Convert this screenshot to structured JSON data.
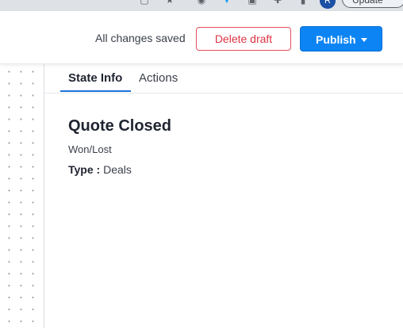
{
  "browser": {
    "update_label": "Update",
    "profile_initial": "R"
  },
  "header": {
    "save_status": "All changes saved",
    "delete_label": "Delete draft",
    "publish_label": "Publish"
  },
  "tabs": [
    {
      "label": "State Info",
      "active": true
    },
    {
      "label": "Actions",
      "active": false
    }
  ],
  "state": {
    "name": "Quote Closed",
    "subtitle": "Won/Lost",
    "type_label": "Type :",
    "type_value": "Deals"
  },
  "colors": {
    "accent": "#0c84f3",
    "danger": "#dc3545",
    "tab_underline": "#1e73d9"
  }
}
